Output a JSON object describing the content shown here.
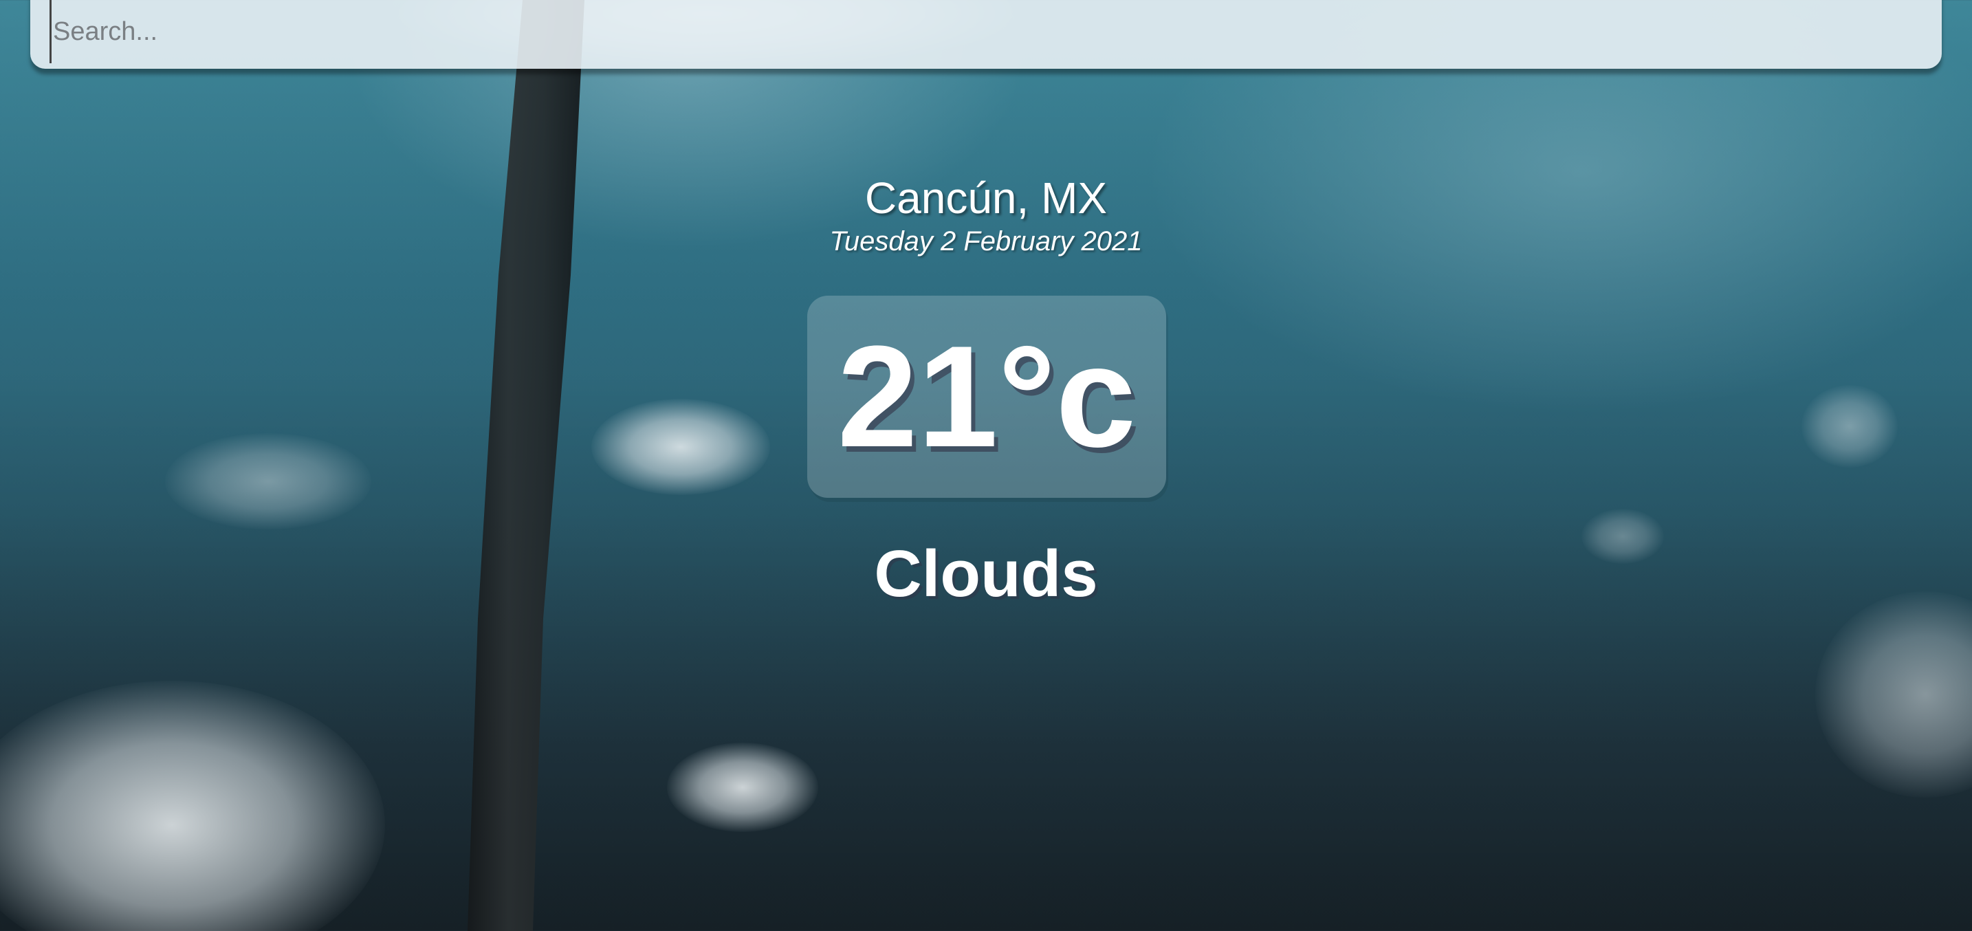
{
  "search": {
    "placeholder": "Search..."
  },
  "location": {
    "city": "Cancún, MX",
    "date": "Tuesday 2 February 2021"
  },
  "weather": {
    "temperature": "21°c",
    "condition": "Clouds"
  },
  "colors": {
    "text": "#ffffff",
    "search_bg": "#e8f0f4",
    "sky": "#3f8799"
  },
  "background": {
    "icon": "sky-with-palm-tree-image"
  }
}
